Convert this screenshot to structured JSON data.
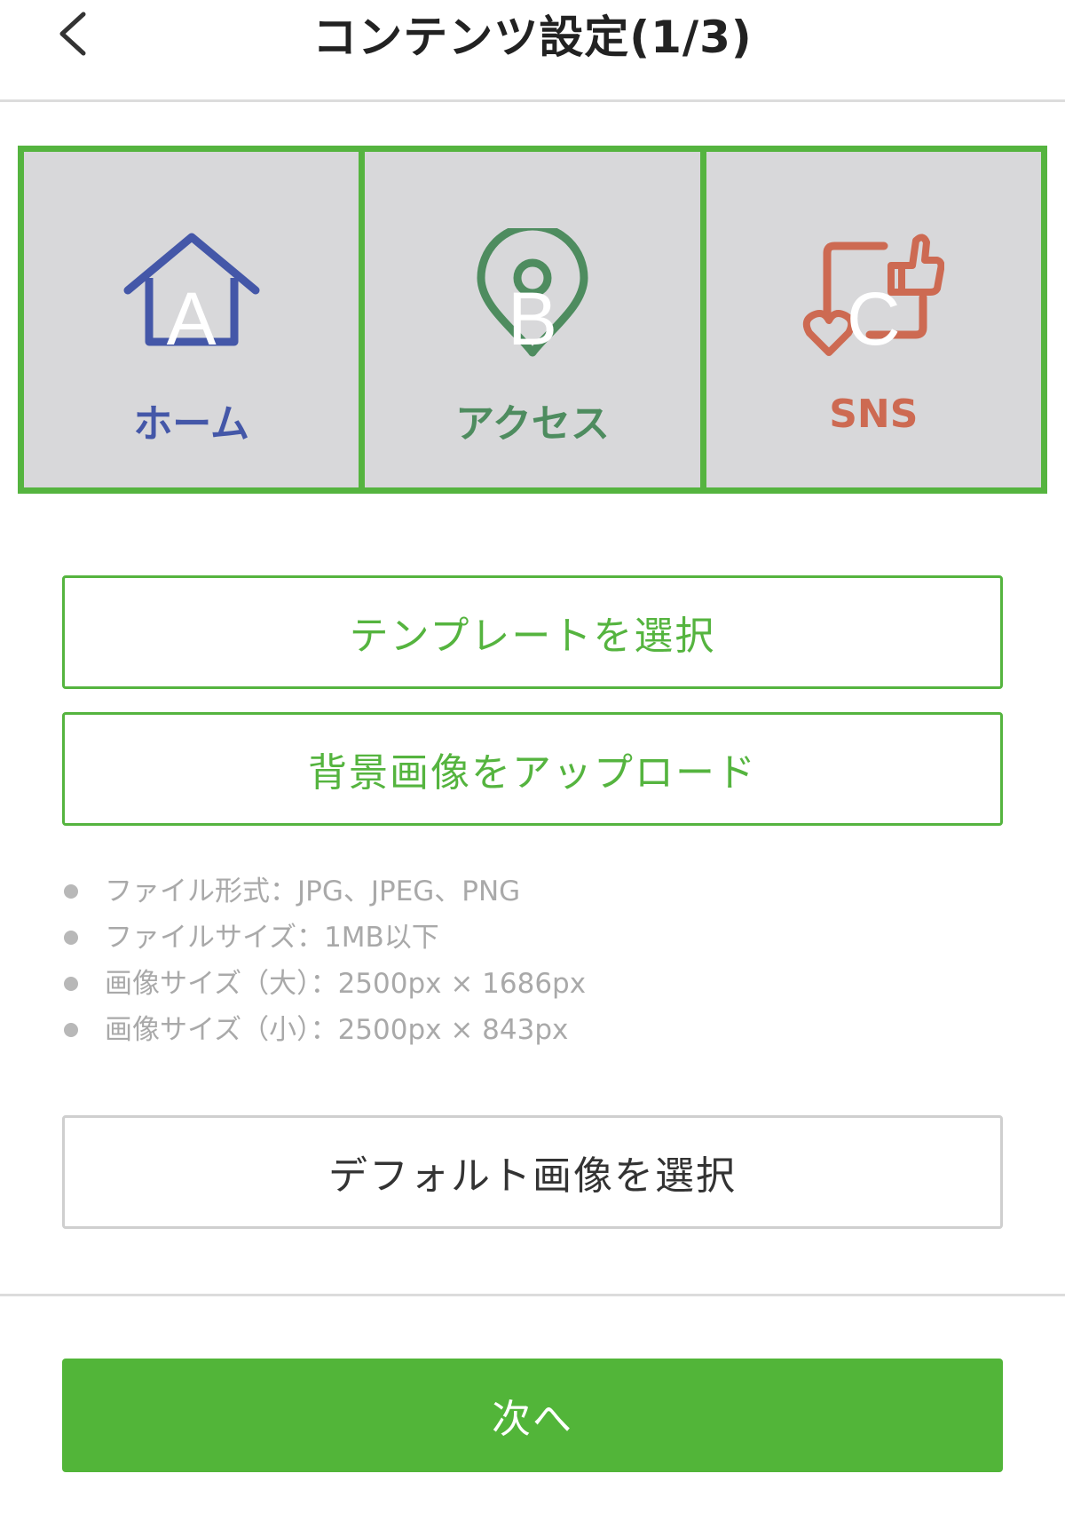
{
  "header": {
    "title": "コンテンツ設定(1/3)"
  },
  "tiles": [
    {
      "letter": "A",
      "label": "ホーム",
      "icon": "home-icon",
      "color": "#4457a8"
    },
    {
      "letter": "B",
      "label": "アクセス",
      "icon": "location-pin-icon",
      "color": "#4e8c5f"
    },
    {
      "letter": "C",
      "label": "SNS",
      "icon": "social-icon",
      "color": "#cd6a52"
    }
  ],
  "buttons": {
    "template": "テンプレートを選択",
    "upload": "背景画像をアップロード",
    "default_image": "デフォルト画像を選択",
    "next": "次へ"
  },
  "notes": [
    "ファイル形式：JPG、JPEG、PNG",
    "ファイルサイズ：1MB以下",
    "画像サイズ（大）：2500px × 1686px",
    "画像サイズ（小）：2500px × 843px"
  ],
  "colors": {
    "accent": "#55b43f",
    "tile_bg": "#d8d8da"
  }
}
